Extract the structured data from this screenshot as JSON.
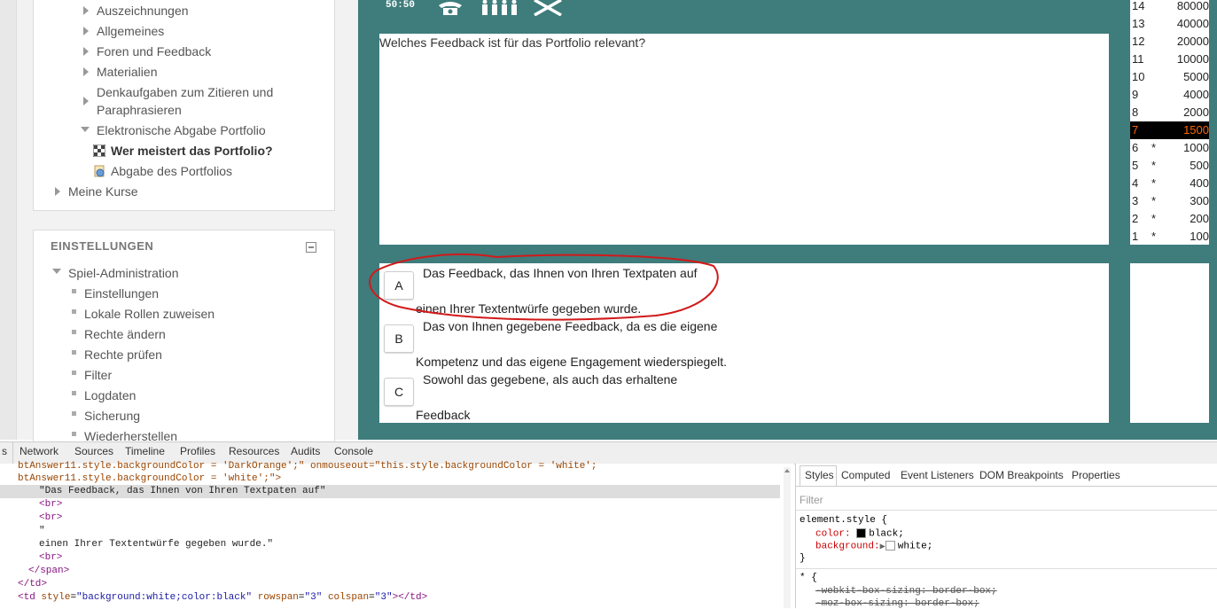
{
  "nav": {
    "items": [
      {
        "label": "Auszeichnungen"
      },
      {
        "label": "Allgemeines"
      },
      {
        "label": "Foren und Feedback"
      },
      {
        "label": "Materialien"
      },
      {
        "label": "Denkaufgaben zum Zitieren und"
      },
      {
        "label": "Paraphrasieren"
      },
      {
        "label": "Elektronische Abgabe Portfolio"
      },
      {
        "label": "Wer meistert das Portfolio?"
      },
      {
        "label": "Abgabe des Portfolios"
      },
      {
        "label": "Meine Kurse"
      }
    ]
  },
  "settings": {
    "title": "EINSTELLUNGEN",
    "admin_label": "Spiel-Administration",
    "items": [
      "Einstellungen",
      "Lokale Rollen zuweisen",
      "Rechte ändern",
      "Rechte prüfen",
      "Filter",
      "Logdaten",
      "Sicherung",
      "Wiederherstellen"
    ]
  },
  "game": {
    "joker_5050": "50:50",
    "question": "Welches Feedback ist für das Portfolio relevant?",
    "answers": [
      {
        "letter": "A",
        "line1": "Das Feedback, das Ihnen von Ihren Textpaten auf",
        "line2": "einen Ihrer Textentwürfe gegeben wurde."
      },
      {
        "letter": "B",
        "line1": "Das von Ihnen gegebene Feedback, da es die eigene",
        "line2": "Kompetenz und das eigene Engagement wiederspiegelt."
      },
      {
        "letter": "C",
        "line1": "Sowohl das gegebene, als auch das erhaltene",
        "line2": "Feedback"
      }
    ],
    "ladder": [
      {
        "level": "14",
        "mark": "",
        "amount": "80000"
      },
      {
        "level": "13",
        "mark": "",
        "amount": "40000"
      },
      {
        "level": "12",
        "mark": "",
        "amount": "20000"
      },
      {
        "level": "11",
        "mark": "",
        "amount": "10000"
      },
      {
        "level": "10",
        "mark": "",
        "amount": "5000"
      },
      {
        "level": "9",
        "mark": "",
        "amount": "4000"
      },
      {
        "level": "8",
        "mark": "",
        "amount": "2000"
      },
      {
        "level": "7",
        "mark": "",
        "amount": "1500"
      },
      {
        "level": "6",
        "mark": "*",
        "amount": "1000"
      },
      {
        "level": "5",
        "mark": "*",
        "amount": "500"
      },
      {
        "level": "4",
        "mark": "*",
        "amount": "400"
      },
      {
        "level": "3",
        "mark": "*",
        "amount": "300"
      },
      {
        "level": "2",
        "mark": "*",
        "amount": "200"
      },
      {
        "level": "1",
        "mark": "*",
        "amount": "100"
      }
    ],
    "current_level": "7"
  },
  "devtools": {
    "tabs": [
      "s",
      "Network",
      "Sources",
      "Timeline",
      "Profiles",
      "Resources",
      "Audits",
      "Console"
    ],
    "code": {
      "line1": "btAnswer11.style.backgroundColor = 'DarkOrange';\" onmouseout=\"this.style.backgroundColor = 'white';",
      "line2": "btAnswer11.style.backgroundColor = 'white';\">",
      "text1": "\"Das Feedback, das Ihnen von Ihren Textpaten auf\"",
      "br": "<br>",
      "quote": "\"",
      "text2": "einen Ihrer Textentwürfe gegeben wurde.\"",
      "span_close": "</span>",
      "td_close": "</td>",
      "td_open": "<td",
      "td_attr1_name": "style",
      "td_attr1_val": "\"background:white;color:black\"",
      "td_attr2_name": "rowspan",
      "td_attr2_val": "\"3\"",
      "td_attr3_name": "colspan",
      "td_attr3_val": "\"3\"",
      "td_tail": "></td>"
    },
    "styles_tabs": [
      "Styles",
      "Computed",
      "Event Listeners",
      "DOM Breakpoints",
      "Properties"
    ],
    "filter_placeholder": "Filter",
    "rule1": {
      "selector": "element.style {",
      "color_prop": "color:",
      "color_val": "black;",
      "bg_prop": "background:",
      "bg_val": "white;",
      "close": "}"
    },
    "rule2": {
      "selector": "* {",
      "p1": "-webkit-box-sizing: border-box;",
      "p2": "-moz-box-sizing: border-box;"
    }
  },
  "colors": {
    "game_bg": "#3f7c7c",
    "highlight_bg": "#000000",
    "highlight_text": "#ff6600",
    "annotation": "#d11a1a"
  }
}
